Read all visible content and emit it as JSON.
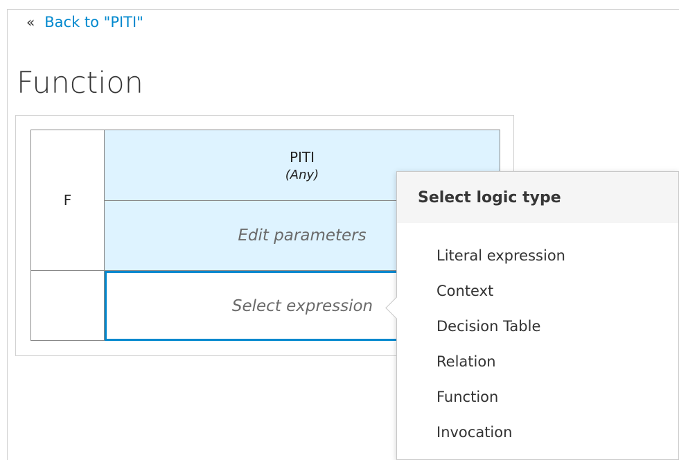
{
  "back_link": {
    "chevrons": "«",
    "label": "Back to \"PITI\""
  },
  "page": {
    "title": "Function"
  },
  "function_grid": {
    "name": "F",
    "header": {
      "name": "PITI",
      "type": "(Any)"
    },
    "params_placeholder": "Edit parameters",
    "expression_placeholder": "Select expression"
  },
  "logic_popover": {
    "title": "Select logic type",
    "items": [
      "Literal expression",
      "Context",
      "Decision Table",
      "Relation",
      "Function",
      "Invocation"
    ]
  },
  "colors": {
    "link": "#0088ce",
    "header_fill": "#def3ff",
    "selection_border": "#0088ce"
  }
}
